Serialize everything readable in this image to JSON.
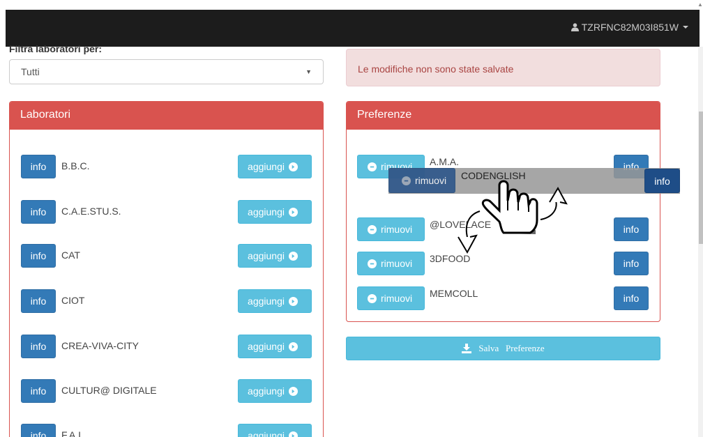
{
  "navbar": {
    "user_id": "TZRFNC82M03I851W"
  },
  "filter": {
    "label": "Filtra laboratori per:",
    "selected": "Tutti"
  },
  "alert": {
    "text": "Le modifiche non sono state salvate"
  },
  "laboratori": {
    "title": "Laboratori",
    "info_label": "info",
    "add_label": "aggiungi",
    "items": [
      {
        "name": "B.B.C."
      },
      {
        "name": "C.A.E.STU.S."
      },
      {
        "name": "CAT"
      },
      {
        "name": "CIOT"
      },
      {
        "name": "CREA-VIVA-CITY"
      },
      {
        "name": "CULTUR@ DIGITALE"
      },
      {
        "name": "F.A.I."
      }
    ]
  },
  "preferenze": {
    "title": "Preferenze",
    "remove_label": "rimuovi",
    "info_label": "info",
    "items": [
      {
        "name": "A.M.A."
      },
      {
        "name": "@LOVELACE"
      },
      {
        "name": "3DFOOD"
      },
      {
        "name": "MEMCOLL"
      }
    ],
    "dragging": {
      "name": "CODENGLISH",
      "remove_label": "rimuovi",
      "info_label": "info"
    }
  },
  "save": {
    "label": "Salva   Preferenze"
  },
  "icons": {
    "user": "user-icon",
    "caret": "caret-down-icon",
    "add": "arrow-circle-right-icon",
    "remove": "minus-circle-icon",
    "download": "download-icon",
    "hand": "hand-pointer-icon",
    "drag_arrows": "curved-arrow-icon"
  },
  "colors": {
    "navbar": "#1c1c1c",
    "danger": "#d9534f",
    "primary": "#337ab7",
    "info": "#5bc0de",
    "alert_bg": "#f2dede",
    "alert_text": "#a94442"
  }
}
